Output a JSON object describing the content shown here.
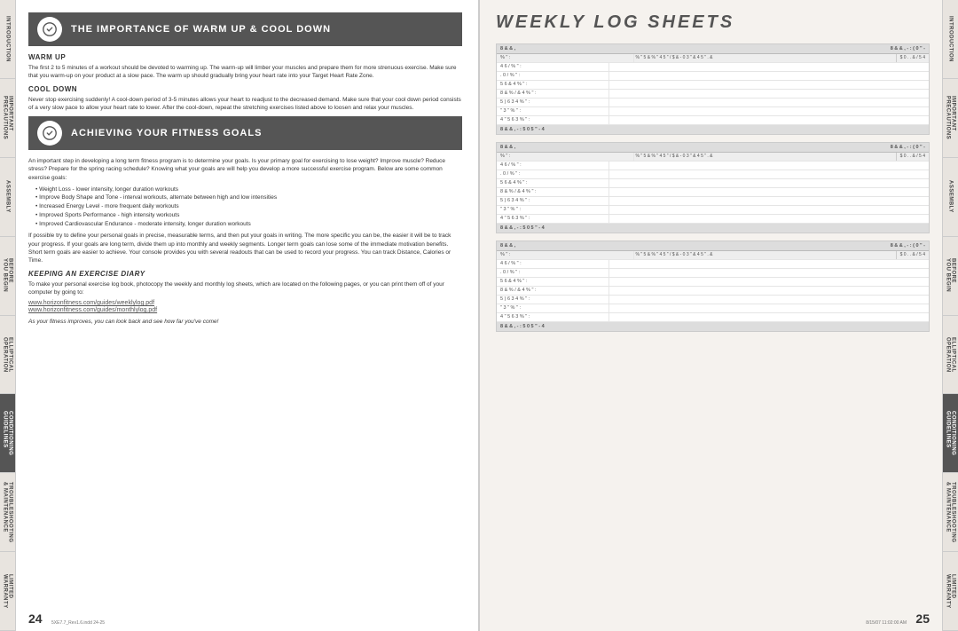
{
  "left_tabs": [
    {
      "label": "INTRODUCTION",
      "active": false
    },
    {
      "label": "IMPORTANT PRECAUTIONS",
      "active": false
    },
    {
      "label": "ASSEMBLY",
      "active": false
    },
    {
      "label": "BEFORE YOU BEGIN",
      "active": false
    },
    {
      "label": "ELLIPTICAL OPERATION",
      "active": false
    },
    {
      "label": "CONDITIONING GUIDELINES",
      "active": true
    },
    {
      "label": "TROUBLESHOOTING & MAINTENANCE",
      "active": false
    },
    {
      "label": "LIMITED WARRANTY",
      "active": false
    }
  ],
  "right_tabs": [
    {
      "label": "INTRODUCTION",
      "active": false
    },
    {
      "label": "IMPORTANT PRECAUTIONS",
      "active": false
    },
    {
      "label": "ASSEMBLY",
      "active": false
    },
    {
      "label": "BEFORE YOU BEGIN",
      "active": false
    },
    {
      "label": "ELLIPTICAL OPERATION",
      "active": false
    },
    {
      "label": "CONDITIONING GUIDELINES",
      "active": true
    },
    {
      "label": "TROUBLESHOOTING & MAINTENANCE",
      "active": false
    },
    {
      "label": "LIMITED WARRANTY",
      "active": false
    }
  ],
  "section1": {
    "icon_label": "5 * 1",
    "title": "THE IMPORTANCE OF WARM UP & COOL DOWN",
    "warm_up_heading": "WARM UP",
    "warm_up_text": "The first 2 to 5 minutes of a workout should be devoted to warming up. The warm-up will limber your muscles and prepare them for more strenuous exercise. Make sure that you warm-up on your product at a slow pace. The warm up should gradually bring your heart rate into your Target Heart Rate Zone.",
    "cool_down_heading": "COOL DOWN",
    "cool_down_text": "Never stop exercising suddenly! A cool-down period of 3-5 minutes allows your heart to readjust to the decreased demand. Make sure that your cool down period consists of a very slow pace to allow your heart rate to lower. After the cool-down, repeat the stretching exercises listed above to loosen and relax your muscles."
  },
  "section2": {
    "icon_label": "5 * 1",
    "title": "ACHIEVING YOUR FITNESS GOALS",
    "intro_text": "An important step in developing a long term fitness program is to determine your goals. Is your primary goal for exercising to lose weight? Improve muscle? Reduce stress? Prepare for the spring racing schedule? Knowing what your goals are will help you develop a more successful exercise program. Below are some common exercise goals:",
    "bullets": [
      "Weight Loss - lower intensity, longer duration workouts",
      "Improve Body Shape and Tone - interval workouts, alternate between high and low intensities",
      "Increased Energy Level - more frequent daily workouts",
      "Improved Sports Performance - high intensity workouts",
      "Improved Cardiovascular Endurance - moderate intensity, longer duration workouts"
    ],
    "detail_text": "If possible try to define your personal goals in precise, measurable terms, and then put your goals in writing. The more specific you can be, the easier it will be to track your progress. If your goals are long term, divide them up into monthly and weekly segments. Longer term goals can lose some of the immediate motivation benefits. Short term goals are easier to achieve. Your console provides you with several readouts that can be used to record your progress. You can track Distance, Calories or Time."
  },
  "section3": {
    "title": "KEEPING AN EXERCISE DIARY",
    "text": "To make your personal exercise log book, photocopy the weekly and monthly log sheets, which are located on the following pages, or you can print them off of your computer by going to:",
    "link1": "www.horizonfitness.com/guides/weeklylog.pdf",
    "link2": "www.horizonfitness.com/guides/monthlylog.pdf",
    "closing_text": "As your fitness improves, you can look back and see how far you've come!"
  },
  "right_page": {
    "title": "WEEKLY LOG SHEETS",
    "log_sheets": [
      {
        "header_left": "8 & & ,",
        "header_mid": "8 & & , - :  ( 0 \" -",
        "col_header_left": "% \" :",
        "col_header_mid": "% \" 5 & % \" 4 5 \" / $ & - 0 3 \" & 4 5 \" . &",
        "col_header_right": "$ 0 . . & / 5 4",
        "rows": [
          {
            "label": "4 6 / % \" :"
          },
          {
            "label": ". 0 / % \" :"
          },
          {
            "label": "5 6 & 4 % \" :"
          },
          {
            "label": "8 & % / & 4 % \" :"
          },
          {
            "label": "5 ) 6 3 4 % \" :"
          },
          {
            "label": "\" 3 \" % \" :"
          },
          {
            "label": "4 \" 5 6 3 % \" :"
          }
        ],
        "footer": "8 & & , - :  5 0 5 \" - 4"
      },
      {
        "header_left": "8 & & ,",
        "header_mid": "8 & & , - :  ( 0 \" -",
        "col_header_left": "% \" :",
        "col_header_mid": "% \" 5 & % \" 4 5 \" / $ & - 0 3 \" & 4 5 \" . &",
        "col_header_right": "$ 0 . . & / 5 4",
        "rows": [
          {
            "label": "4 6 / % \" :"
          },
          {
            "label": ". 0 / % \" :"
          },
          {
            "label": "5 6 & 4 % \" :"
          },
          {
            "label": "8 & % / & 4 % \" :"
          },
          {
            "label": "5 ) 6 3 4 % \" :"
          },
          {
            "label": "\" 3 \" % \" :"
          },
          {
            "label": "4 \" 5 6 3 % \" :"
          }
        ],
        "footer": "8 & & , - :  5 0 5 \" - 4"
      },
      {
        "header_left": "8 & & ,",
        "header_mid": "8 & & , - :  ( 0 \" -",
        "col_header_left": "% \" :",
        "col_header_mid": "% \" 5 & % \" 4 5 \" / $ & - 0 3 \" & 4 5 \" . &",
        "col_header_right": "$ 0 . . & / 5 4",
        "rows": [
          {
            "label": "4 6 / % \" :"
          },
          {
            "label": ". 0 / % \" :"
          },
          {
            "label": "5 6 & 4 % \" :"
          },
          {
            "label": "8 & % / & 4 % \" :"
          },
          {
            "label": "5 ) 6 3 4 % \" :"
          },
          {
            "label": "\" 3 \" % \" :"
          },
          {
            "label": "4 \" 5 6 3 % \" :"
          }
        ],
        "footer": "8 & & , - :  5 0 5 \" - 4"
      }
    ]
  },
  "page_numbers": {
    "left": "24",
    "right": "25"
  },
  "footer": {
    "left": "5XE7.7_Rev1.6.indd  24-25",
    "right": "8/15/07  11:02:00 AM"
  }
}
